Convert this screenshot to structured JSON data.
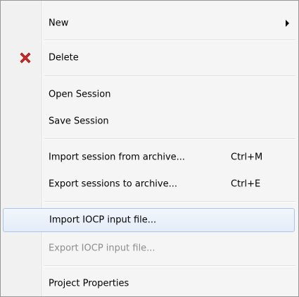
{
  "context_menu": {
    "items": [
      {
        "label": "New",
        "has_submenu": true
      },
      {
        "label": "Delete",
        "icon": "delete-x-icon"
      },
      {
        "label": "Open Session"
      },
      {
        "label": "Save Session"
      },
      {
        "label": "Import session from archive...",
        "shortcut": "Ctrl+M"
      },
      {
        "label": "Export sessions to archive...",
        "shortcut": "Ctrl+E"
      },
      {
        "label": "Import IOCP input file...",
        "state": "hovered"
      },
      {
        "label": "Export IOCP input file...",
        "state": "disabled"
      },
      {
        "label": "Project Properties"
      }
    ]
  },
  "colors": {
    "menu_background": "#f0f0f0",
    "hover_border": "#a9c5ea",
    "disabled_text": "#8d8d8d",
    "delete_icon": "#d12a2a"
  }
}
